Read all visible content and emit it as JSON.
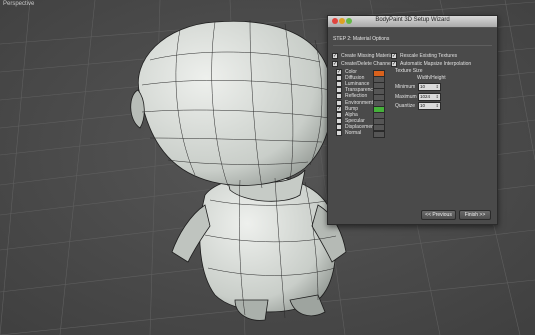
{
  "viewport": {
    "label": "Perspective"
  },
  "wizard": {
    "title": "BodyPaint 3D Setup Wizard",
    "step": "STEP 2: Material Options",
    "options": [
      {
        "label": "Create Missing Materials",
        "checked": true
      },
      {
        "label": "Create/Delete Channels",
        "checked": true
      },
      {
        "label": "Rescale Existing Textures",
        "checked": true
      },
      {
        "label": "Automatic Mapsize Interpolation",
        "checked": true
      }
    ],
    "channels": [
      {
        "label": "Color",
        "checked": true,
        "swatch": "#d9611c"
      },
      {
        "label": "Diffusion",
        "checked": false,
        "swatch": ""
      },
      {
        "label": "Luminance",
        "checked": false,
        "swatch": ""
      },
      {
        "label": "Transparency",
        "checked": false,
        "swatch": ""
      },
      {
        "label": "Reflection",
        "checked": false,
        "swatch": ""
      },
      {
        "label": "Environment",
        "checked": false,
        "swatch": ""
      },
      {
        "label": "Bump",
        "checked": true,
        "swatch": "#45b13a"
      },
      {
        "label": "Alpha",
        "checked": false,
        "swatch": ""
      },
      {
        "label": "Specular",
        "checked": false,
        "swatch": ""
      },
      {
        "label": "Displacement",
        "checked": false,
        "swatch": ""
      },
      {
        "label": "Normal",
        "checked": false,
        "swatch": ""
      }
    ],
    "texture_size": {
      "heading": "Texture Size",
      "column_header": "Width/Height",
      "fields": [
        {
          "label": "Minimum",
          "value": "10"
        },
        {
          "label": "Maximum",
          "value": "1024"
        },
        {
          "label": "Quantize",
          "value": "10"
        }
      ]
    },
    "buttons": {
      "previous": "<< Previous",
      "finish": "Finish >>"
    }
  }
}
